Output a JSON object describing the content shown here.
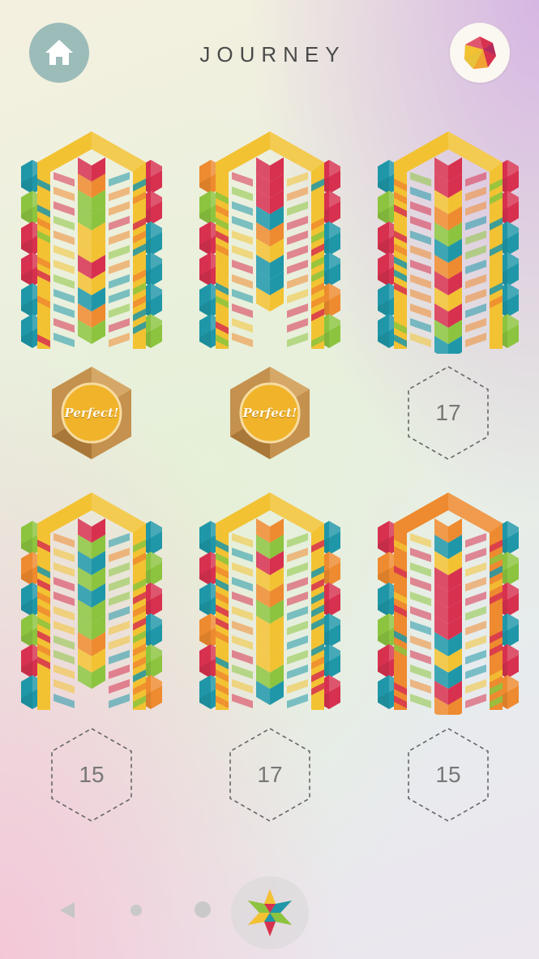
{
  "header": {
    "title": "JOURNEY",
    "home_icon": "home-icon",
    "profile_icon": "faceted-gem-icon",
    "home_bg": "#9cbcb9"
  },
  "palette": {
    "yellow": "#f2c233",
    "orange": "#ee8a2f",
    "red": "#d7314f",
    "green": "#8cc43f",
    "teal": "#1f97a8"
  },
  "levels": [
    {
      "status": "perfect",
      "label": "Perfect!"
    },
    {
      "status": "perfect",
      "label": "Perfect!"
    },
    {
      "status": "moves",
      "label": "17"
    },
    {
      "status": "moves",
      "label": "15"
    },
    {
      "status": "moves",
      "label": "17"
    },
    {
      "status": "moves",
      "label": "15"
    }
  ],
  "pager": {
    "back_icon": "triangle-left-icon",
    "pages": 3,
    "current_icon": "star-polyhedron-icon"
  }
}
